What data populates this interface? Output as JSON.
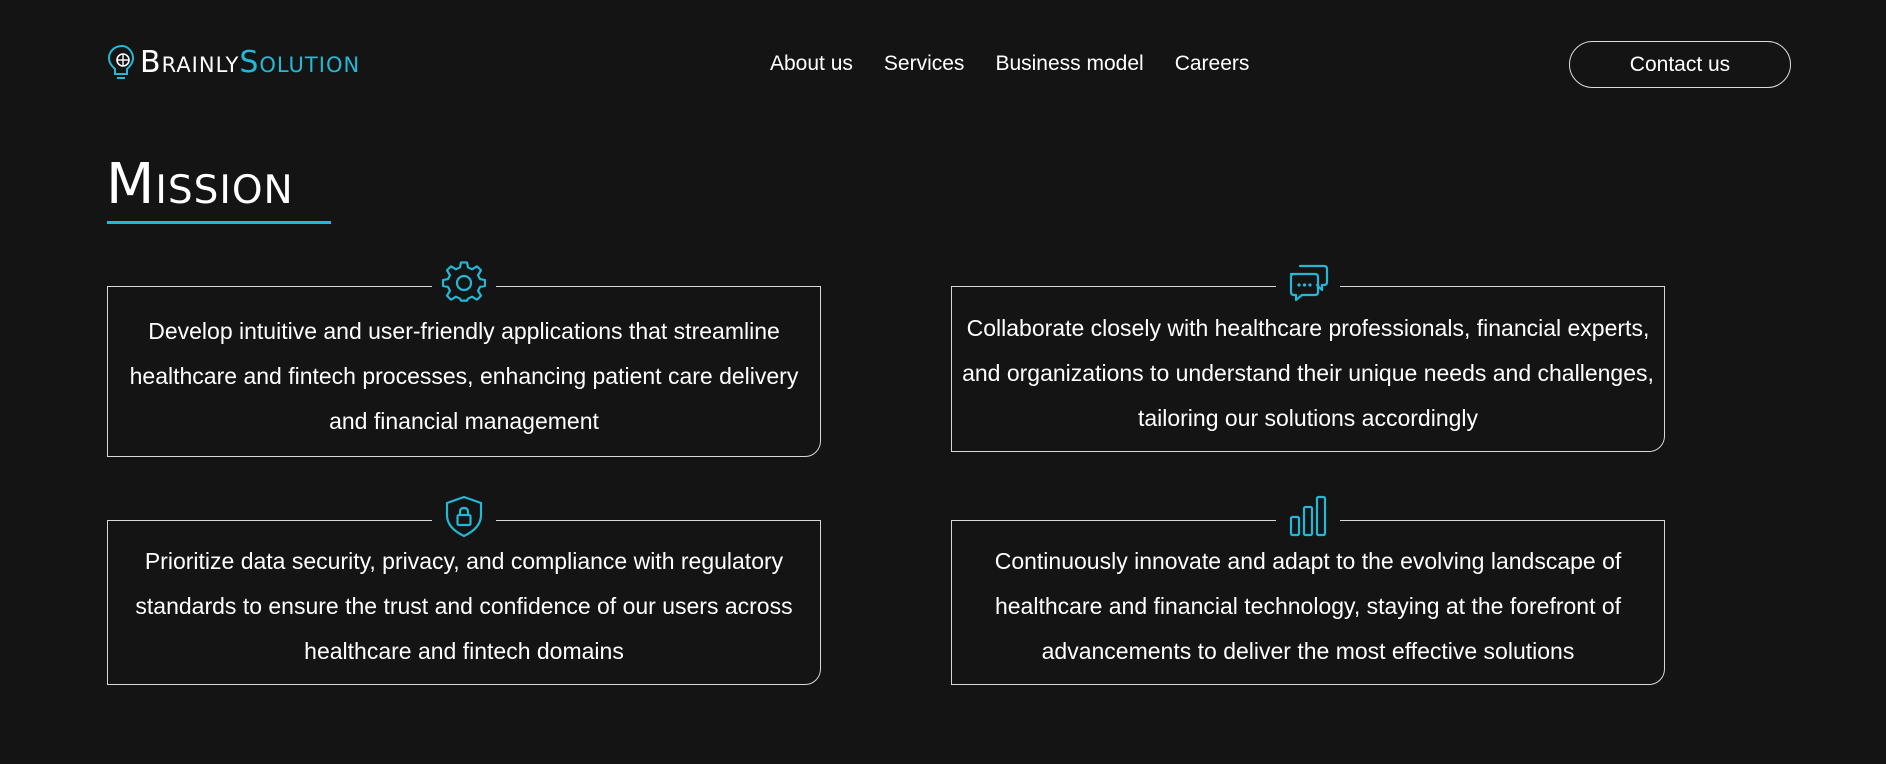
{
  "header": {
    "logo": {
      "part1": "Brainly",
      "part2": "Solution"
    },
    "nav": [
      "About us",
      "Services",
      "Business model",
      "Careers"
    ],
    "contact_label": "Contact us"
  },
  "mission": {
    "title": "Mission",
    "cards": [
      {
        "icon": "gear-icon",
        "text": "Develop intuitive and user-friendly applications that streamline healthcare and fintech processes, enhancing patient care delivery and financial management"
      },
      {
        "icon": "chat-bubbles-icon",
        "text": "Collaborate closely with healthcare professionals, financial experts, and organizations to understand their unique needs and challenges, tailoring our solutions accordingly"
      },
      {
        "icon": "shield-lock-icon",
        "text": "Prioritize data security, privacy, and compliance with regulatory standards to ensure the trust and confidence of our users across healthcare and fintech domains"
      },
      {
        "icon": "bar-chart-icon",
        "text": "Continuously innovate and adapt to the evolving landscape of healthcare and financial technology, staying at the forefront of advancements to deliver the most effective solutions"
      }
    ]
  },
  "colors": {
    "background": "#141414",
    "accent": "#22b8d6",
    "text": "#ffffff",
    "border": "#d8d8d8"
  }
}
